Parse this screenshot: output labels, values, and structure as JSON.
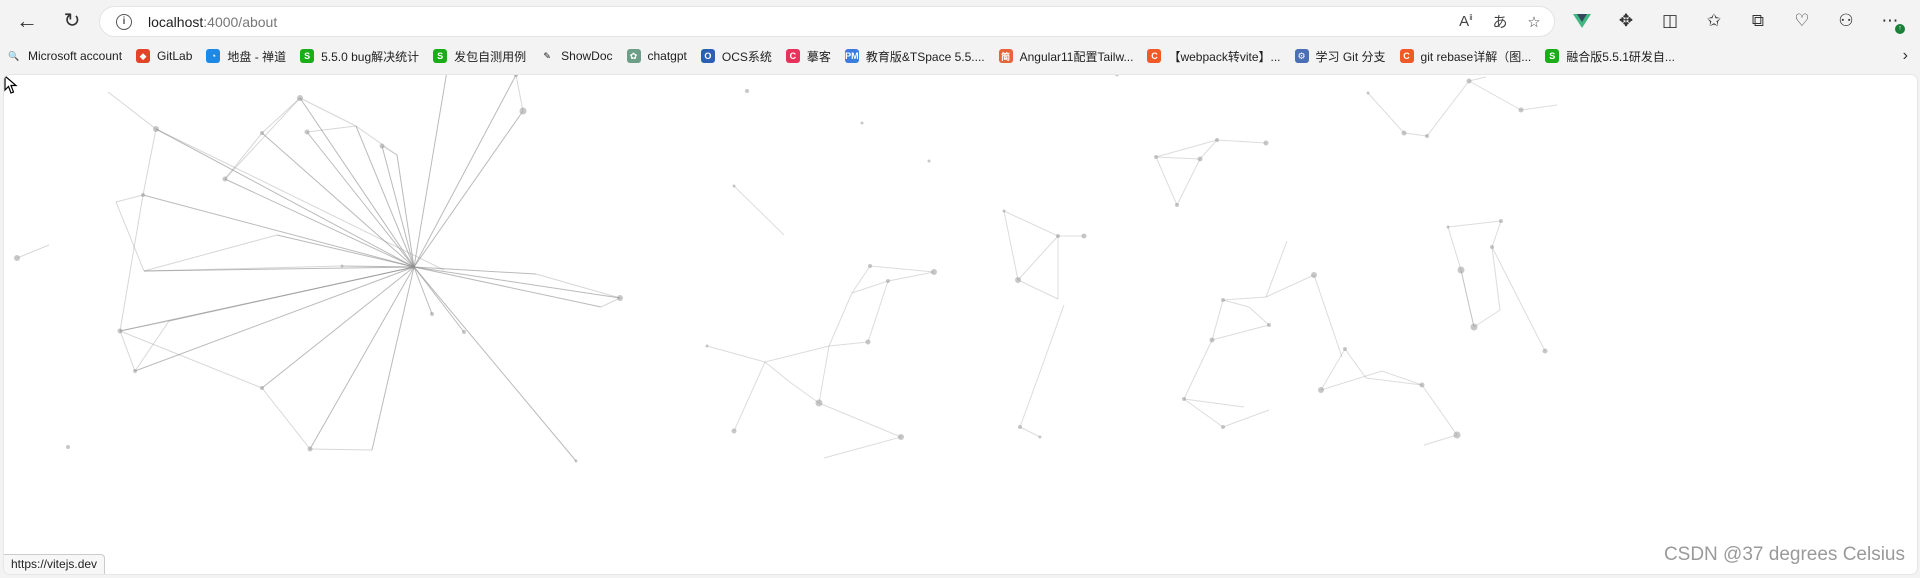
{
  "browser": {
    "url_host": "localhost",
    "url_path": ":4000/about",
    "nav": {
      "back_icon": "arrow-left-icon",
      "refresh_icon": "refresh-icon",
      "info_icon": "info-icon"
    }
  },
  "bookmarks": [
    {
      "label": "Microsoft account",
      "fav_color": "#2b63d9",
      "fav_glyph": "🔍"
    },
    {
      "label": "GitLab",
      "fav_color": "#e24329",
      "fav_glyph": "◆"
    },
    {
      "label": "地盘 - 禅道",
      "fav_color": "#1e88e5",
      "fav_glyph": "◔"
    },
    {
      "label": "5.5.0 bug解决统计",
      "fav_color": "#1aad19",
      "fav_glyph": "S"
    },
    {
      "label": "发包自测用例",
      "fav_color": "#1aad19",
      "fav_glyph": "S"
    },
    {
      "label": "ShowDoc",
      "fav_color": "#111111",
      "fav_glyph": "✎"
    },
    {
      "label": "chatgpt",
      "fav_color": "#6c9e88",
      "fav_glyph": "✿"
    },
    {
      "label": "OCS系统",
      "fav_color": "#2b5fb4",
      "fav_glyph": "O"
    },
    {
      "label": "摹客",
      "fav_color": "#e8315b",
      "fav_glyph": "C"
    },
    {
      "label": "教育版&TSpace 5.5....",
      "fav_color": "#3c7be0",
      "fav_glyph": "PM"
    },
    {
      "label": "Angular11配置Tailw...",
      "fav_color": "#e8623a",
      "fav_glyph": "简"
    },
    {
      "label": "【webpack转vite】...",
      "fav_color": "#f05a28",
      "fav_glyph": "C"
    },
    {
      "label": "学习 Git 分支",
      "fav_color": "#4a6fb5",
      "fav_glyph": "⚙"
    },
    {
      "label": "git rebase详解（图...",
      "fav_color": "#f05a28",
      "fav_glyph": "C"
    },
    {
      "label": "融合版5.5.1研发自...",
      "fav_color": "#1aad19",
      "fav_glyph": "S"
    }
  ],
  "status_bar": {
    "hover_url": "https://vitejs.dev"
  },
  "watermark": "CSDN @37 degrees Celsius"
}
